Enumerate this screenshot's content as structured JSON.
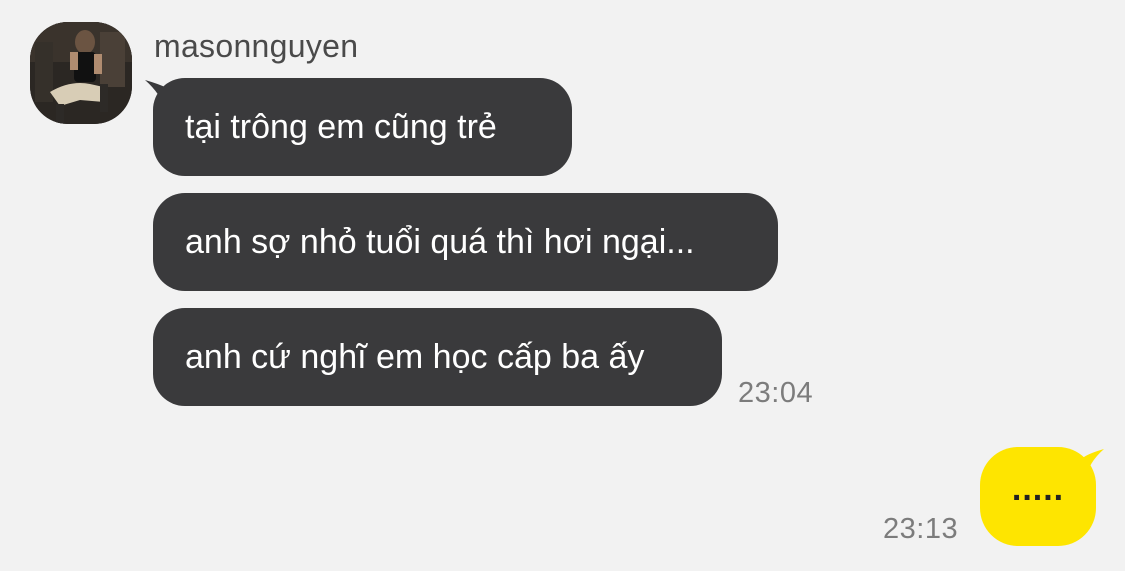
{
  "chat": {
    "sender": {
      "name": "masonnguyen"
    },
    "incoming_messages": [
      {
        "text": "tại trông em cũng trẻ"
      },
      {
        "text": "anh sợ nhỏ tuổi quá thì hơi ngại..."
      },
      {
        "text": "anh cứ nghĩ em học cấp ba ấy"
      }
    ],
    "incoming_time": "23:04",
    "outgoing_messages": [
      {
        "text": "....."
      }
    ],
    "outgoing_time": "23:13"
  },
  "colors": {
    "background": "#f2f2f2",
    "incoming_bubble": "#3a3a3c",
    "incoming_text": "#ffffff",
    "outgoing_bubble": "#fee500",
    "outgoing_text": "#222222",
    "timestamp": "#7c7c7c"
  }
}
